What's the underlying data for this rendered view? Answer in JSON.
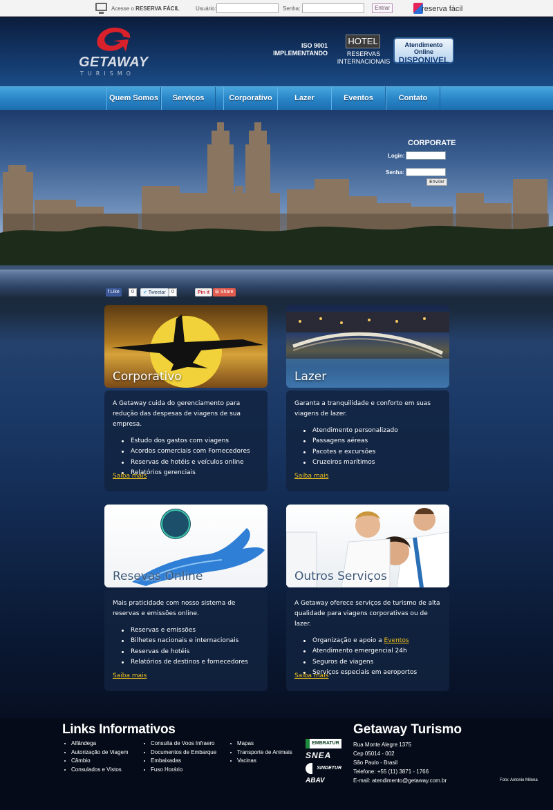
{
  "topbar": {
    "access_text": "Acesse o",
    "access_brand": "RESERVA FÁCIL",
    "user_label": "Usuário:",
    "password_label": "Senha:",
    "enter_label": "Entrar",
    "partner_logo": "reserva fácil"
  },
  "header": {
    "logo_name": "GETAWAY",
    "logo_sub": "TURISMO",
    "iso_line1": "ISO 9001",
    "iso_line2": "IMPLEMENTANDO",
    "hotel_label": "HOTEL",
    "hotel_sub1": "RESERVAS",
    "hotel_sub2": "INTERNACIONAIS",
    "online_line1": "Atendimento Online",
    "online_line2": "DISPONIVEL"
  },
  "nav": [
    "Quem Somos",
    "Serviços",
    "Corporativo",
    "Lazer",
    "Eventos",
    "Contato"
  ],
  "corporate": {
    "title": "CORPORATE",
    "login_label": "Login:",
    "password_label": "Senha:",
    "send_label": "Enviar"
  },
  "social": {
    "like": "Like",
    "like_count": "0",
    "tweet": "Tweetar",
    "tweet_count": "0",
    "pin": "Pin it",
    "share": "Share"
  },
  "cards": [
    {
      "caption": "Corporativo",
      "intro": "A Getaway cuida do gerenciamento para redução das despesas de viagens de sua empresa.",
      "items": [
        "Estudo dos gastos com viagens",
        "Acordos comerciais com Fornecedores",
        "Reservas de hotéis e veículos online",
        "Relatórios gerenciais"
      ],
      "more": "Saiba mais"
    },
    {
      "caption": "Lazer",
      "intro": "Garanta a tranquilidade e conforto em suas viagens de lazer.",
      "items": [
        "Atendimento personalizado",
        "Passagens aéreas",
        "Pacotes e excursões",
        "Cruzeiros marítimos"
      ],
      "more": "Saiba mais"
    },
    {
      "caption": "Resevas Online",
      "intro": "Mais praticidade com nosso sistema de reservas e emissões online.",
      "items": [
        "Reservas e emissões",
        "Bilhetes nacionais e internacionais",
        "Reservas de hotéis",
        "Relatórios de destinos e fornecedores"
      ],
      "more": "Saiba mais"
    },
    {
      "caption": "Outros Serviços",
      "intro": "A Getaway oferece serviços de turismo de alta qualidade para viagens corporativas ou de lazer.",
      "items_first_prefix": "Organização e apoio a",
      "items_first_link": "Eventos",
      "items": [
        "Atendimento emergencial 24h",
        "Seguros de viagens",
        "Serviços especiais em aeroportos"
      ],
      "more": "Saiba mais"
    }
  ],
  "footer": {
    "links_title": "Links Informativos",
    "col1": [
      "Alfândega",
      "Autorização de Viagem",
      "Câmbio",
      "Consulados e Vistos"
    ],
    "col2": [
      "Consulta de Voos Infraero",
      "Documentos de Embarque",
      "Embaixadas",
      "Fuso Horário"
    ],
    "col3": [
      "Mapas",
      "Transporte de Animais",
      "Vacinas"
    ],
    "assoc": [
      "EMBRATUR",
      "SNEA",
      "SINDETUR",
      "ABAV"
    ],
    "company_title": "Getaway Turismo",
    "address": "Rua Monte Alegre 1375",
    "cep": "Cep 05014 - 002",
    "city": "São Paulo - Brasil",
    "phone": "Telefone: +55 (11) 3871 - 1766",
    "email": "E-mail: atendimento@getaway.com.br",
    "photo_credit": "Foto: Antonio Milena"
  }
}
